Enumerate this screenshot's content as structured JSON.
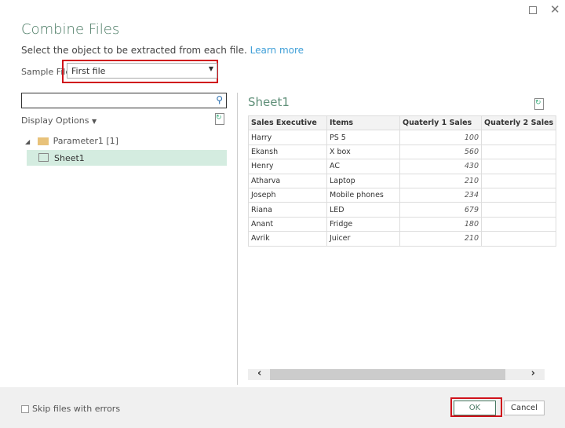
{
  "dialog": {
    "title": "Combine Files",
    "subtitle": "Select the object to be extracted from each file.",
    "learn_more": "Learn more"
  },
  "sample_file": {
    "label": "Sample File:",
    "value": "First file"
  },
  "search": {
    "value": ""
  },
  "display_options": "Display Options",
  "tree": {
    "folder": "Parameter1 [1]",
    "item": "Sheet1"
  },
  "preview": {
    "title": "Sheet1",
    "columns": [
      "Sales Executive",
      "Items",
      "Quaterly 1 Sales",
      "Quaterly 2 Sales"
    ],
    "rows": [
      [
        "Harry",
        "PS 5",
        "100",
        ""
      ],
      [
        "Ekansh",
        "X box",
        "560",
        ""
      ],
      [
        "Henry",
        "AC",
        "430",
        ""
      ],
      [
        "Atharva",
        "Laptop",
        "210",
        ""
      ],
      [
        "Joseph",
        "Mobile phones",
        "234",
        ""
      ],
      [
        "Riana",
        "LED",
        "679",
        ""
      ],
      [
        "Anant",
        "Fridge",
        "180",
        ""
      ],
      [
        "Avrik",
        "Juicer",
        "210",
        ""
      ]
    ]
  },
  "footer": {
    "skip_label": "Skip files with errors",
    "ok": "OK",
    "cancel": "Cancel"
  },
  "colors": {
    "accent": "#4a7a63",
    "highlight": "#d0121b",
    "selected": "#d4ece0"
  }
}
